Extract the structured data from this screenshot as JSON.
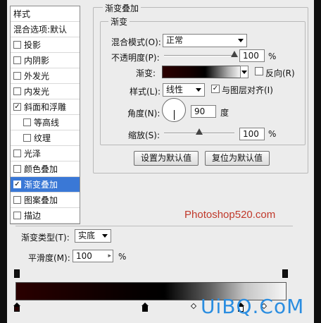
{
  "stylelist": {
    "header": "样式",
    "blend_header": "混合选项:默认",
    "items": [
      {
        "label": "投影",
        "checked": false,
        "indent": false,
        "selected": false
      },
      {
        "label": "内阴影",
        "checked": false,
        "indent": false,
        "selected": false
      },
      {
        "label": "外发光",
        "checked": false,
        "indent": false,
        "selected": false
      },
      {
        "label": "内发光",
        "checked": false,
        "indent": false,
        "selected": false
      },
      {
        "label": "斜面和浮雕",
        "checked": true,
        "indent": false,
        "selected": false
      },
      {
        "label": "等高线",
        "checked": false,
        "indent": true,
        "selected": false
      },
      {
        "label": "纹理",
        "checked": false,
        "indent": true,
        "selected": false
      },
      {
        "label": "光泽",
        "checked": false,
        "indent": false,
        "selected": false
      },
      {
        "label": "颜色叠加",
        "checked": false,
        "indent": false,
        "selected": false
      },
      {
        "label": "渐变叠加",
        "checked": true,
        "indent": false,
        "selected": true
      },
      {
        "label": "图案叠加",
        "checked": false,
        "indent": false,
        "selected": false
      },
      {
        "label": "描边",
        "checked": false,
        "indent": false,
        "selected": false
      }
    ]
  },
  "overlay": {
    "title": "渐变叠加",
    "section_title": "渐变",
    "blend_mode_label": "混合模式(O):",
    "blend_mode_value": "正常",
    "opacity_label": "不透明度(P):",
    "opacity_value": "100",
    "opacity_unit": "%",
    "opacity_level": 1.0,
    "gradient_label": "渐变:",
    "reverse_label": "反向(R)",
    "reverse_checked": false,
    "style_label": "样式(L):",
    "style_value": "线性",
    "align_label": "与图层对齐(I)",
    "align_checked": true,
    "angle_label": "角度(N):",
    "angle_value": "90",
    "angle_unit": "度",
    "scale_label": "缩放(S):",
    "scale_value": "100",
    "scale_unit": "%",
    "scale_level": 0.5,
    "set_default_button": "设置为默认值",
    "reset_default_button": "复位为默认值"
  },
  "watermark": "Photoshop520.com",
  "editor": {
    "gradient_type_label": "渐变类型(T):",
    "gradient_type_value": "实底",
    "smoothness_label": "平滑度(M):",
    "smoothness_value": "100",
    "smoothness_unit": "%"
  },
  "logo": "UiBQ.CoM",
  "colors": {
    "selection": "#3a78d6",
    "gradient_start": "#2a0000",
    "gradient_end": "#f6f6f6",
    "watermark": "#c0392b",
    "logo": "#2a8de0"
  }
}
